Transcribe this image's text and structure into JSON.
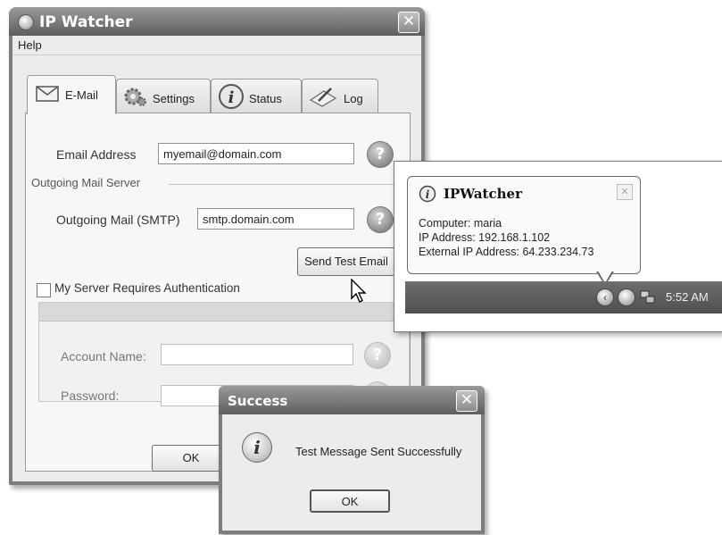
{
  "main_window": {
    "title": "IP Watcher",
    "close_glyph": "✕",
    "menu": {
      "help": "Help"
    },
    "tabs": [
      {
        "label": "E-Mail",
        "icon": "envelope-icon"
      },
      {
        "label": "Settings",
        "icon": "gears-icon"
      },
      {
        "label": "Status",
        "icon": "info-icon"
      },
      {
        "label": "Log",
        "icon": "log-icon"
      }
    ],
    "email": {
      "email_label": "Email Address",
      "email_value": "myemail@domain.com",
      "group_label": "Outgoing Mail Server",
      "smtp_label": "Outgoing Mail (SMTP)",
      "smtp_value": "smtp.domain.com",
      "send_test_label": "Send Test Email",
      "auth_label": "My Server Requires Authentication",
      "account_label": "Account Name:",
      "password_label": "Password:",
      "help_glyph": "?"
    },
    "ok_label": "OK"
  },
  "tray_popup": {
    "balloon_title": "IPWatcher",
    "close_glyph": "✕",
    "lines": [
      "Computer: maria",
      "IP Address: 192.168.1.102",
      "External IP Address: 64.233.234.73"
    ],
    "clock": "5:52 AM",
    "chevron_glyph": "‹"
  },
  "success_dialog": {
    "title": "Success",
    "close_glyph": "✕",
    "message": "Test Message Sent Successfully",
    "ok_label": "OK",
    "info_glyph": "i"
  }
}
